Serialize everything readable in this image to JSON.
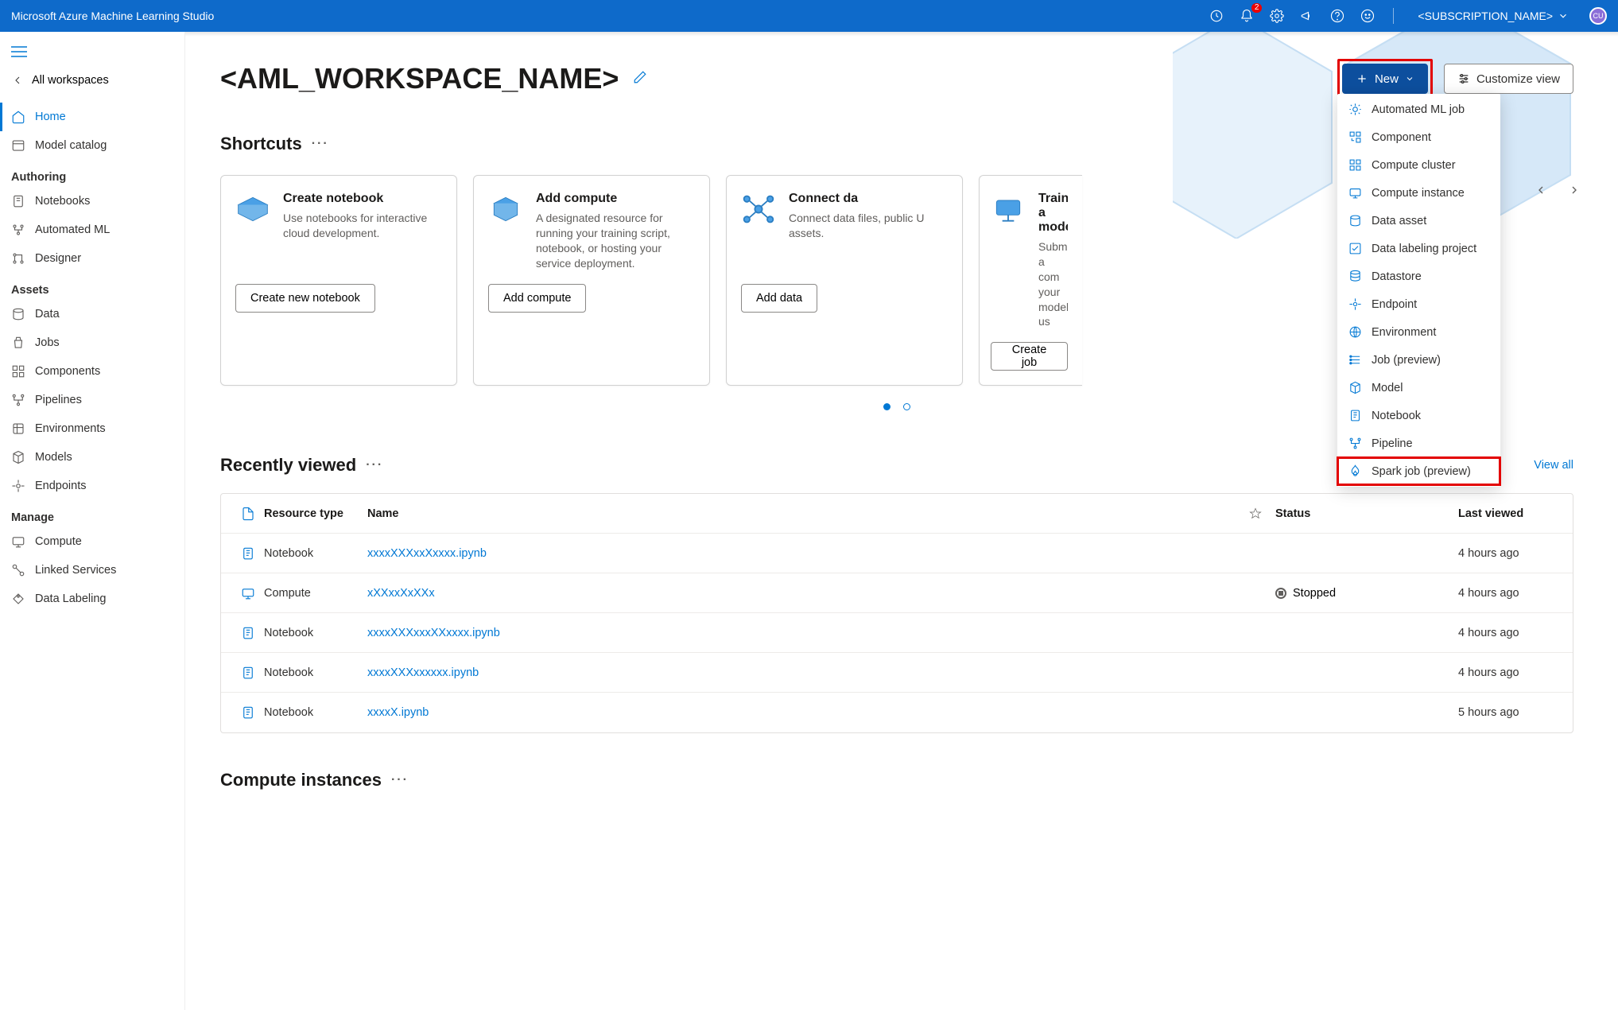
{
  "topbar": {
    "brand": "Microsoft Azure Machine Learning Studio",
    "notification_count": "2",
    "subscription": "<SUBSCRIPTION_NAME>",
    "avatar_label": "CU"
  },
  "sidebar": {
    "back_label": "All workspaces",
    "sections": {
      "home": "Home",
      "model_catalog": "Model catalog",
      "authoring_heading": "Authoring",
      "notebooks": "Notebooks",
      "automated_ml": "Automated ML",
      "designer": "Designer",
      "assets_heading": "Assets",
      "data": "Data",
      "jobs": "Jobs",
      "components": "Components",
      "pipelines": "Pipelines",
      "environments": "Environments",
      "models": "Models",
      "endpoints": "Endpoints",
      "manage_heading": "Manage",
      "compute": "Compute",
      "linked_services": "Linked Services",
      "data_labeling": "Data Labeling"
    }
  },
  "page": {
    "title": "<AML_WORKSPACE_NAME>",
    "new_button": "New",
    "customize_button": "Customize view",
    "shortcuts_heading": "Shortcuts",
    "dots": "···",
    "recently_viewed_heading": "Recently viewed",
    "view_all": "View all",
    "compute_instances_heading": "Compute instances"
  },
  "new_menu": [
    "Automated ML job",
    "Component",
    "Compute cluster",
    "Compute instance",
    "Data asset",
    "Data labeling project",
    "Datastore",
    "Endpoint",
    "Environment",
    "Job (preview)",
    "Model",
    "Notebook",
    "Pipeline",
    "Spark job (preview)"
  ],
  "cards": [
    {
      "title": "Create notebook",
      "desc": "Use notebooks for interactive cloud development.",
      "button": "Create new notebook"
    },
    {
      "title": "Add compute",
      "desc": "A designated resource for running your training script, notebook, or hosting your service deployment.",
      "button": "Add compute"
    },
    {
      "title": "Connect da",
      "desc": "Connect data files, public U assets.",
      "button": "Add data"
    },
    {
      "title": "Train a mode",
      "desc": "Submit a com your model us",
      "button": "Create job"
    }
  ],
  "table": {
    "head": {
      "resource_type": "Resource type",
      "name": "Name",
      "status": "Status",
      "last_viewed": "Last viewed"
    },
    "rows": [
      {
        "type": "Notebook",
        "name": "xxxxXXXxxXxxxx.ipynb",
        "status": "",
        "time": "4 hours ago",
        "icon": "notebook"
      },
      {
        "type": "Compute",
        "name": "xXXxxXxXXx",
        "status": "Stopped",
        "time": "4 hours ago",
        "icon": "compute"
      },
      {
        "type": "Notebook",
        "name": "xxxxXXXxxxXXxxxx.ipynb",
        "status": "",
        "time": "4 hours ago",
        "icon": "notebook"
      },
      {
        "type": "Notebook",
        "name": "xxxxXXXxxxxxx.ipynb",
        "status": "",
        "time": "4 hours ago",
        "icon": "notebook"
      },
      {
        "type": "Notebook",
        "name": "xxxxX.ipynb",
        "status": "",
        "time": "5 hours ago",
        "icon": "notebook"
      }
    ]
  }
}
